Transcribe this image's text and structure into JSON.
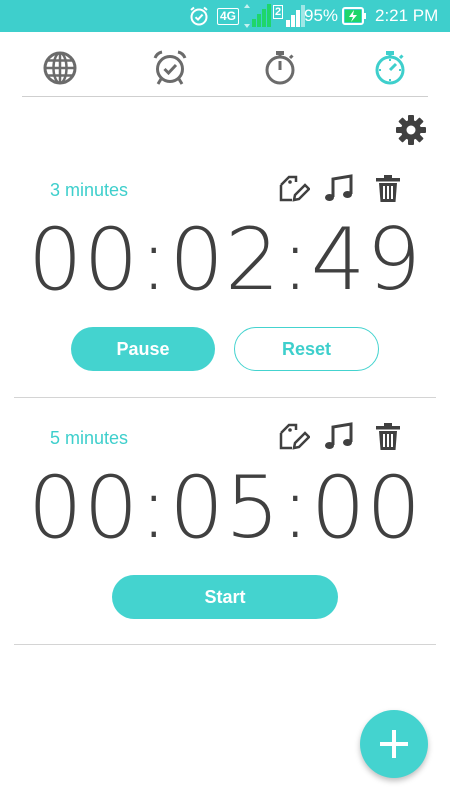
{
  "status_bar": {
    "network": "4G",
    "sim_slot": "2",
    "battery": "95%",
    "time": "2:21 PM"
  },
  "tabs": [
    {
      "name": "world-clock",
      "icon": "globe-icon",
      "active": false
    },
    {
      "name": "alarm",
      "icon": "alarm-clock-icon",
      "active": false
    },
    {
      "name": "stopwatch",
      "icon": "stopwatch-icon",
      "active": false
    },
    {
      "name": "timer",
      "icon": "timer-icon",
      "active": true
    }
  ],
  "timers": [
    {
      "label": "3 minutes",
      "time": "00:02:49",
      "primary_button": "Pause",
      "secondary_button": "Reset"
    },
    {
      "label": "5 minutes",
      "time": "00:05:00",
      "primary_button": "Start"
    }
  ],
  "colors": {
    "accent": "#3ecfcc",
    "text": "#404040",
    "icon_inactive": "#6b6b6b"
  }
}
